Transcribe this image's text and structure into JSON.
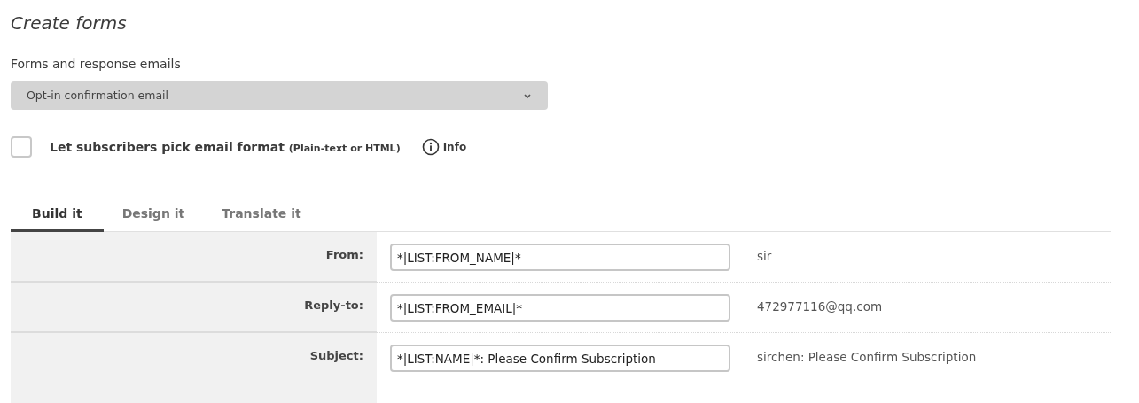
{
  "page": {
    "title": "Create forms"
  },
  "form_select": {
    "label": "Forms and response emails",
    "value": "Opt-in confirmation email"
  },
  "format_option": {
    "label": "Let subscribers pick email format",
    "hint": "(Plain-text or HTML)",
    "checked": false,
    "info": "Info"
  },
  "tabs": [
    {
      "label": "Build it",
      "selected": true
    },
    {
      "label": "Design it",
      "selected": false
    },
    {
      "label": "Translate it",
      "selected": false
    }
  ],
  "fields": [
    {
      "label": "From:",
      "value": "*|LIST:FROM_NAME|*",
      "preview": "sir"
    },
    {
      "label": "Reply-to:",
      "value": "*|LIST:FROM_EMAIL|*",
      "preview": "472977116@qq.com"
    },
    {
      "label": "Subject:",
      "value": "*|LIST:NAME|*: Please Confirm Subscription",
      "preview": "sirchen: Please Confirm Subscription"
    }
  ]
}
